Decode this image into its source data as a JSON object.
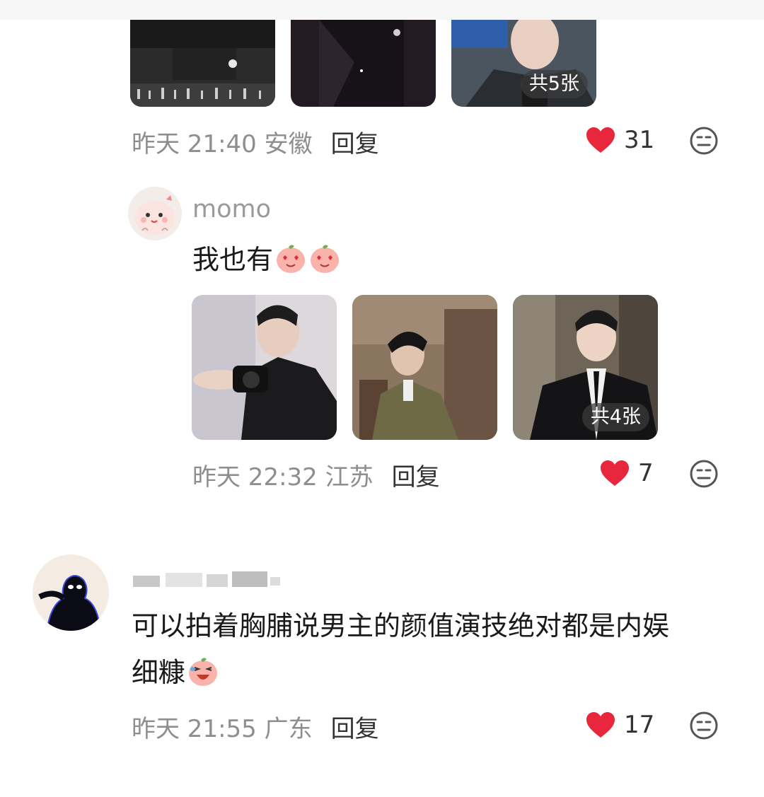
{
  "comments": [
    {
      "id": "c1",
      "image_count_badge": "共5张",
      "time": "昨天 21:40 安徽",
      "reply_label": "回复",
      "like_count": "31"
    },
    {
      "id": "c2",
      "username": "momo",
      "text": "我也有",
      "emojis": [
        "heart-eyes-peach-emoji",
        "heart-eyes-peach-emoji"
      ],
      "image_count_badge": "共4张",
      "time": "昨天 22:32 江苏",
      "reply_label": "回复",
      "like_count": "7"
    },
    {
      "id": "c3",
      "username_redacted": true,
      "text_line1": "可以拍着胸脯说男主的颜值演技绝对都是内娱",
      "text_line2": "细糠",
      "emojis": [
        "laughing-peach-emoji"
      ],
      "time": "昨天 21:55 广东",
      "reply_label": "回复",
      "like_count": "17"
    }
  ],
  "colors": {
    "like_heart": "#e8263c",
    "meta_gray": "#8e8e8e",
    "username_gray": "#9a9a9a"
  },
  "icons": {
    "like": "heart-icon",
    "emoji_reaction": "neutral-face-icon"
  }
}
